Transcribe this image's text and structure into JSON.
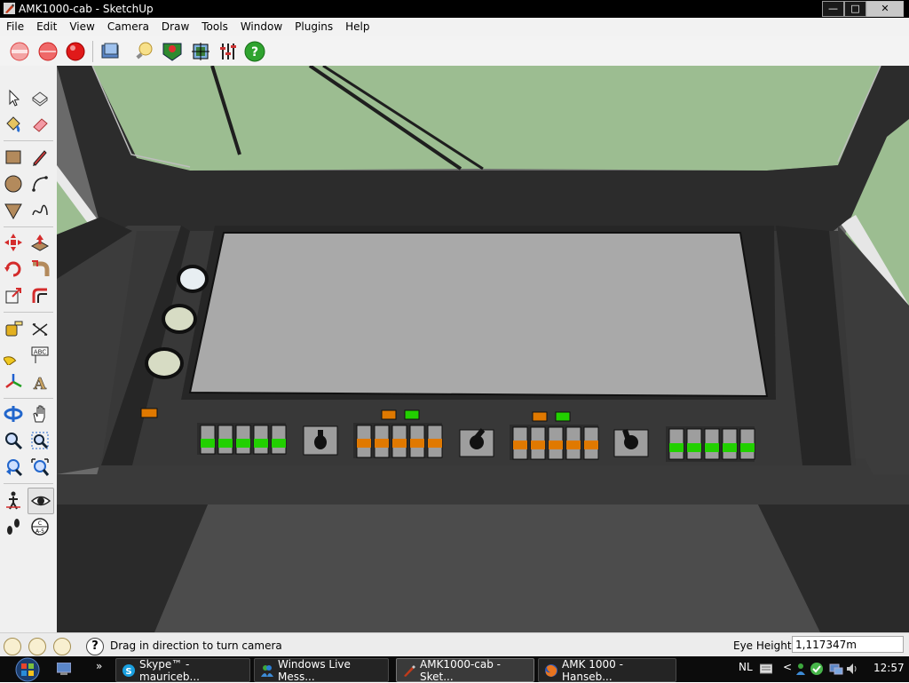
{
  "window": {
    "title": "AMK1000-cab - SketchUp",
    "min": "—",
    "max": "□",
    "close": "✕"
  },
  "menu": [
    "File",
    "Edit",
    "View",
    "Camera",
    "Draw",
    "Tools",
    "Window",
    "Plugins",
    "Help"
  ],
  "toolbar_icons": [
    "record-icon",
    "record-icon",
    "record-icon",
    "image-icon",
    "bulb-icon",
    "landscape-icon",
    "texture-icon",
    "sliders-icon",
    "help-icon"
  ],
  "palette_icons": [
    "select-icon",
    "component-icon",
    "paint-bucket-icon",
    "eraser-icon",
    "rectangle-icon",
    "pencil-icon",
    "circle-icon",
    "arc-icon",
    "polygon-icon",
    "freehand-icon",
    "move-icon",
    "push-pull-icon",
    "rotate-icon",
    "follow-me-icon",
    "scale-icon",
    "offset-icon",
    "tape-measure-icon",
    "dimension-icon",
    "protractor-icon",
    "text-icon",
    "axes-icon",
    "3d-text-icon",
    "orbit-icon",
    "pan-icon",
    "zoom-icon",
    "zoom-window-icon",
    "previous-view-icon",
    "zoom-extents-icon",
    "walk-icon",
    "look-around-icon",
    "footprints-icon",
    "section-plane-icon"
  ],
  "status": {
    "message": "Drag in direction to turn camera",
    "measure_label": "Eye Height",
    "measure_value": "1,117347m"
  },
  "taskbar": {
    "tasks": [
      "Skype™ - mauriceb...",
      "Windows Live Mess...",
      "AMK1000-cab - Sket...",
      "AMK 1000 - Hanseb..."
    ],
    "language": "NL",
    "clock": "12:57",
    "quick_launch_more": "»",
    "tray_arrow": "<"
  },
  "colors": {
    "window_title_bg": "#000000",
    "sky": "#9cbd91",
    "cab_dark": "#2f2f2f",
    "panel": "#3b3b3b",
    "screen": "#a9a9a9",
    "switch_green": "#22d000",
    "switch_orange": "#e07900"
  }
}
